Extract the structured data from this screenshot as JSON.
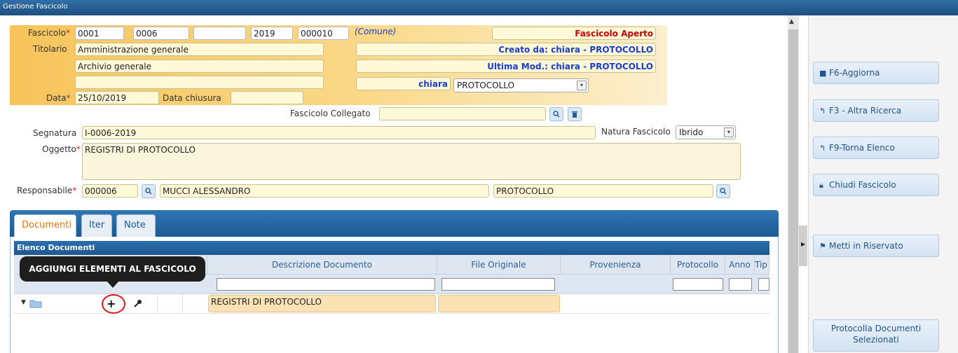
{
  "window": {
    "title": "Gestione Fascicolo"
  },
  "header": {
    "fascicolo_label": "Fascicolo",
    "fascicolo_codes": [
      "0001",
      "0006",
      "",
      "2019",
      "000010"
    ],
    "comune_label": "(Comune)",
    "status": "Fascicolo Aperto",
    "titolario_label": "Titolario",
    "titolario_1": "Amministrazione generale",
    "titolario_2": "Archivio generale",
    "titolario_3": "",
    "created_by": "Creato da: chiara - PROTOCOLLO",
    "last_mod": "Ultima Mod.: chiara - PROTOCOLLO",
    "user": "chiara",
    "office_select": "PROTOCOLLO",
    "data_label": "Data",
    "data_value": "25/10/2019",
    "data_chiusura_label": "Data chiusura",
    "data_chiusura_value": ""
  },
  "form": {
    "collegato_label": "Fascicolo Collegato",
    "collegato_value": "",
    "segnatura_label": "Segnatura",
    "segnatura_value": "I-0006-2019",
    "natura_label": "Natura Fascicolo",
    "natura_value": "Ibrido",
    "oggetto_label": "Oggetto",
    "oggetto_value": "REGISTRI DI PROTOCOLLO",
    "responsabile_label": "Responsabile",
    "responsabile_code": "000006",
    "responsabile_name": "MUCCI ALESSANDRO",
    "responsabile_office": "PROTOCOLLO"
  },
  "tabs": [
    {
      "label": "Documenti",
      "active": true
    },
    {
      "label": "Iter",
      "active": false
    },
    {
      "label": "Note",
      "active": false
    }
  ],
  "grid": {
    "title": "Elenco Documenti",
    "columns": [
      "Descrizione Documento",
      "File Originale",
      "Provenienza",
      "Protocollo",
      "Anno",
      "Tip"
    ],
    "rows": [
      {
        "descrizione": "REGISTRI DI PROTOCOLLO",
        "file": "",
        "provenienza": "",
        "protocollo": "",
        "anno": ""
      }
    ]
  },
  "tooltip": "AGGIUNGI ELEMENTI AL FASCICOLO",
  "sidebar": {
    "buttons": [
      {
        "label": "F6-Aggiorna",
        "icon": "save-icon"
      },
      {
        "label": "F3 - Altra Ricerca",
        "icon": "back-arrow-icon"
      },
      {
        "label": "F9-Torna Elenco",
        "icon": "back-arrow-icon"
      },
      {
        "label": "Chiudi Fascicolo",
        "icon": "lock-icon"
      },
      {
        "label": "Metti in Riservato",
        "icon": "flag-icon"
      }
    ],
    "protocolla_line1": "Protocolla Documenti",
    "protocolla_line2": "Selezionati"
  },
  "colors": {
    "accent": "#1d5a92",
    "header_band": "#f7c45a",
    "required": "#d22222",
    "status_red": "#d00000"
  }
}
